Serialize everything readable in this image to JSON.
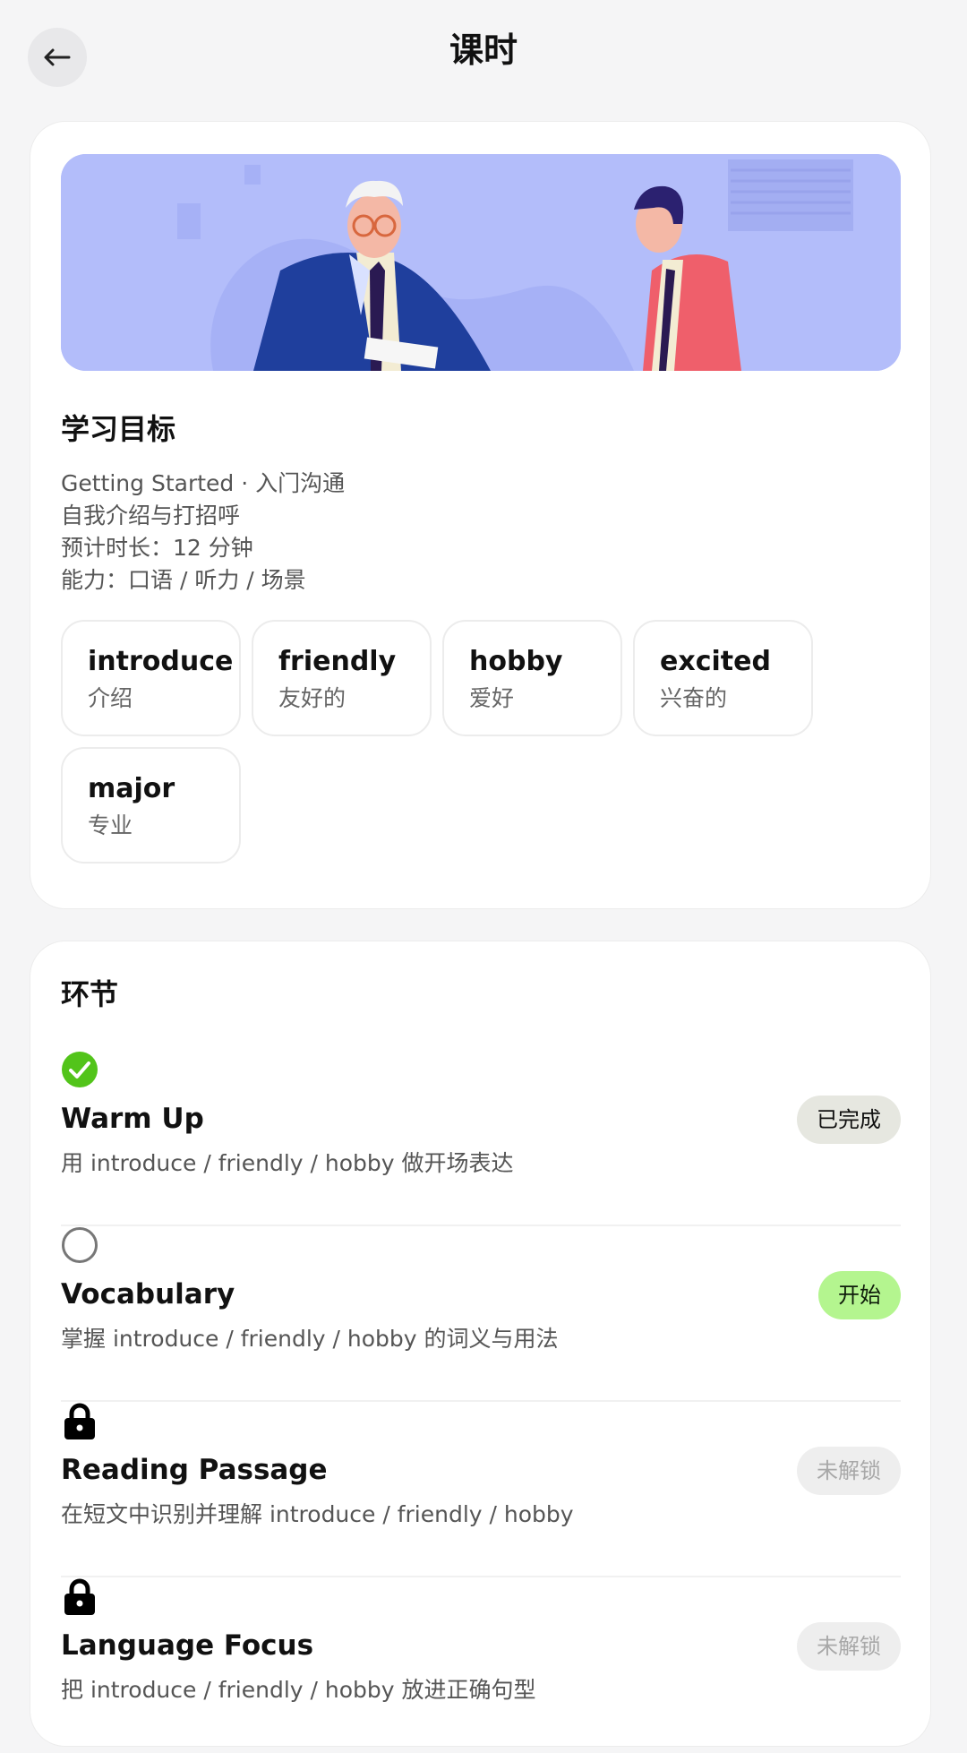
{
  "header": {
    "title": "课时",
    "back_icon": "arrow-left-icon"
  },
  "goal": {
    "title": "学习目标",
    "lines": [
      "Getting Started · 入门沟通",
      "自我介绍与打招呼",
      "预计时长：12 分钟",
      "能力：口语 / 听力 / 场景"
    ],
    "vocab": [
      {
        "word": "introduce",
        "meaning": "介绍"
      },
      {
        "word": "friendly",
        "meaning": "友好的"
      },
      {
        "word": "hobby",
        "meaning": "爱好"
      },
      {
        "word": "excited",
        "meaning": "兴奋的"
      },
      {
        "word": "major",
        "meaning": "专业"
      }
    ]
  },
  "steps": {
    "title": "环节",
    "items": [
      {
        "name": "Warm Up",
        "desc": "用 introduce / friendly / hobby 做开场表达",
        "action": "已完成",
        "status": "done",
        "icon": "check-circle-icon"
      },
      {
        "name": "Vocabulary",
        "desc": "掌握 introduce / friendly / hobby 的词义与用法",
        "action": "开始",
        "status": "start",
        "icon": "empty-circle-icon"
      },
      {
        "name": "Reading Passage",
        "desc": "在短文中识别并理解 introduce / friendly / hobby",
        "action": "未解锁",
        "status": "locked",
        "icon": "lock-icon"
      },
      {
        "name": "Language Focus",
        "desc": "把 introduce / friendly / hobby 放进正确句型",
        "action": "未解锁",
        "status": "locked",
        "icon": "lock-icon"
      }
    ]
  },
  "colors": {
    "done_green": "#52c41a",
    "start_button": "#b4f58f",
    "banner_bg": "#b3bdfa"
  }
}
